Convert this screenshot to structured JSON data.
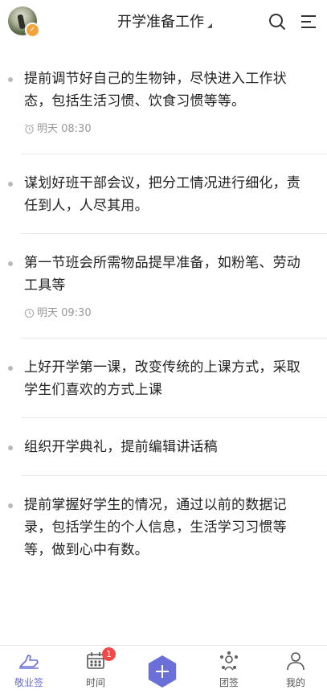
{
  "header": {
    "title": "开学准备工作"
  },
  "tasks": [
    {
      "text": "提前调节好自己的生物钟，尽快进入工作状态，包括生活习惯、饮食习惯等等。",
      "reminder": "明天 08:30"
    },
    {
      "text": "谋划好班干部会议，把分工情况进行细化，责任到人，人尽其用。"
    },
    {
      "text": "第一节班会所需物品提早准备，如粉笔、劳动工具等",
      "reminder": "明天 09:30"
    },
    {
      "text": "上好开学第一课，改变传统的上课方式，采取学生们喜欢的方式上课"
    },
    {
      "text": "组织开学典礼，提前编辑讲话稿"
    },
    {
      "text": "提前掌握好学生的情况，通过以前的数据记录，包括学生的个人信息，生活学习习惯等等，做到心中有数。"
    }
  ],
  "tabbar": {
    "items": [
      {
        "label": "敬业签",
        "icon": "hand-icon"
      },
      {
        "label": "时间",
        "icon": "calendar-icon",
        "badge": "1"
      },
      {
        "label": "",
        "icon": "plus-icon"
      },
      {
        "label": "团签",
        "icon": "group-icon"
      },
      {
        "label": "我的",
        "icon": "user-icon"
      }
    ]
  },
  "colors": {
    "accent": "#6b6fd8",
    "badge": "#f24848"
  }
}
